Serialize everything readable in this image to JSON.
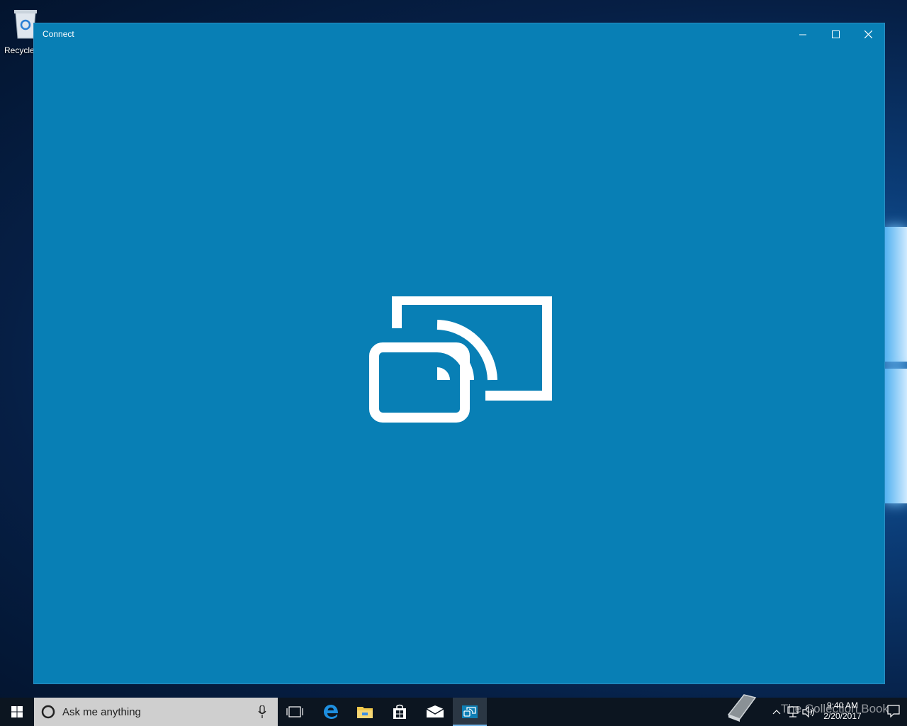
{
  "desktop": {
    "recycle_bin_label": "Recycle"
  },
  "window": {
    "title": "Connect",
    "minimize_icon": "minimize-icon",
    "maximize_icon": "maximize-icon",
    "close_icon": "close-icon",
    "background": "#087fb5",
    "hero_icon": "connect-icon"
  },
  "taskbar": {
    "search_placeholder": "Ask me anything",
    "apps": [
      "task-view-icon",
      "edge-icon",
      "file-explorer-icon",
      "store-icon",
      "mail-icon",
      "connect-icon"
    ],
    "active_app": "connect-icon"
  },
  "tray": {
    "time": "9:40 AM",
    "date": "2/20/2017",
    "watermark": "The Collection Book"
  }
}
